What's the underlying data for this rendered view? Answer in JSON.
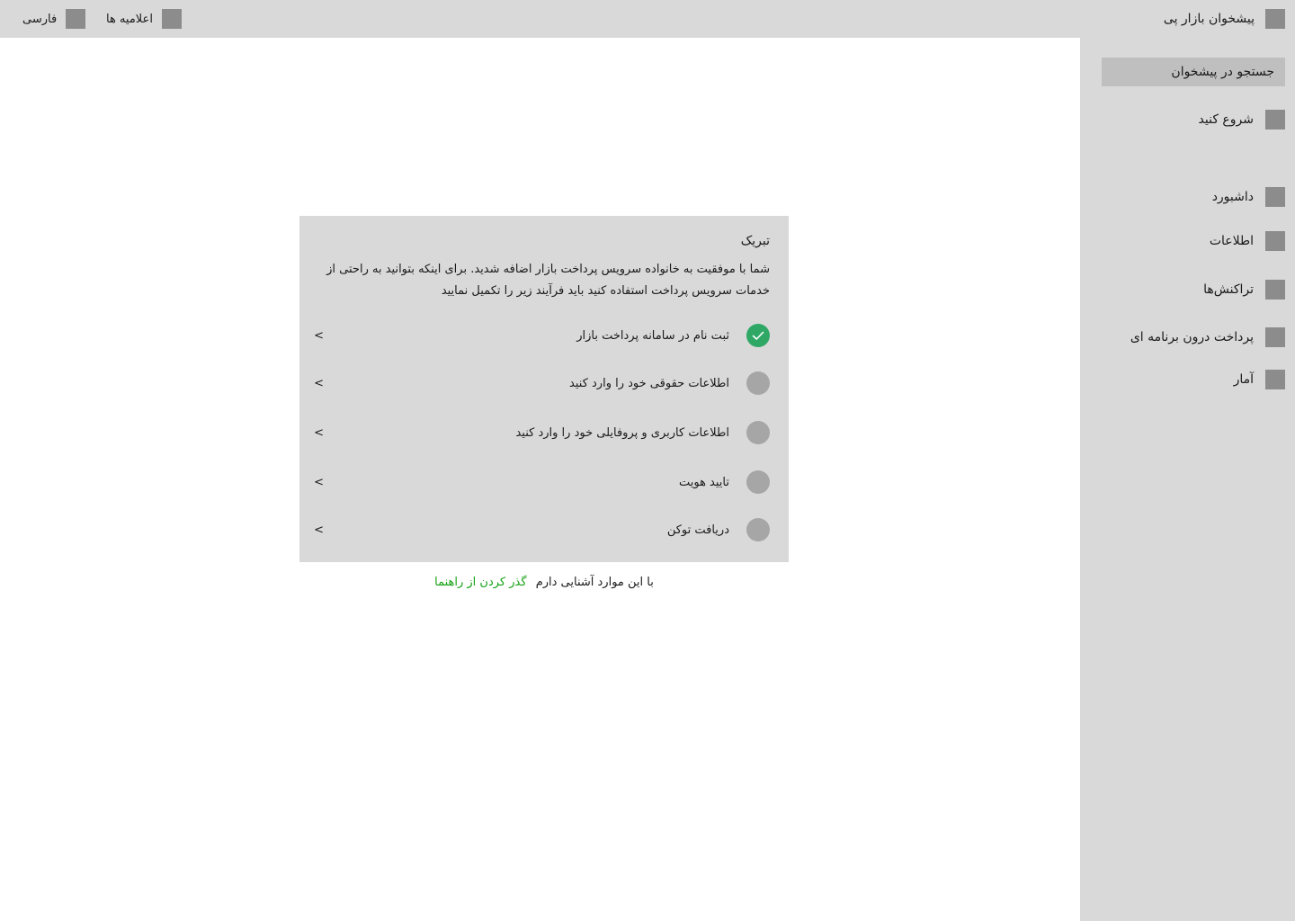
{
  "topbar": {
    "brand_title": "پیشخوان بازار پی",
    "announcements_label": "اعلامیه ها",
    "language_label": "فارسی"
  },
  "sidebar": {
    "search_label": "جستجو در پیشخوان",
    "items": [
      {
        "label": "شروع کنید"
      },
      {
        "label": "داشبورد"
      },
      {
        "label": "اطلاعات"
      },
      {
        "label": "تراکنش‌ها"
      },
      {
        "label": "پرداخت درون برنامه ای"
      },
      {
        "label": "آمار"
      }
    ]
  },
  "card": {
    "title": "تبریک",
    "description": "شما با موفقیت به خانواده سرویس پرداخت بازار اضافه شدید. برای اینکه بتوانید به راحتی از خدمات سرویس پرداخت استفاده کنید باید فرآیند زیر را تکمیل نمایید",
    "chevron": ">",
    "steps": [
      {
        "label": "ثبت نام در سامانه پرداخت بازار",
        "done": true
      },
      {
        "label": "اطلاعات حقوقی خود را وارد کنید",
        "done": false
      },
      {
        "label": "اطلاعات کاربری و پروفایلی خود را وارد کنید",
        "done": false
      },
      {
        "label": "تایید هویت",
        "done": false
      },
      {
        "label": "دریافت توکن",
        "done": false
      }
    ]
  },
  "footer": {
    "familiar_text": "با این موارد آشنایی دارم",
    "skip_link": "گذر کردن از راهنما"
  },
  "colors": {
    "done_step": "#2fa866",
    "pending_step": "#a6a6a6",
    "link": "#16a216",
    "panel": "#d9d9d9"
  }
}
